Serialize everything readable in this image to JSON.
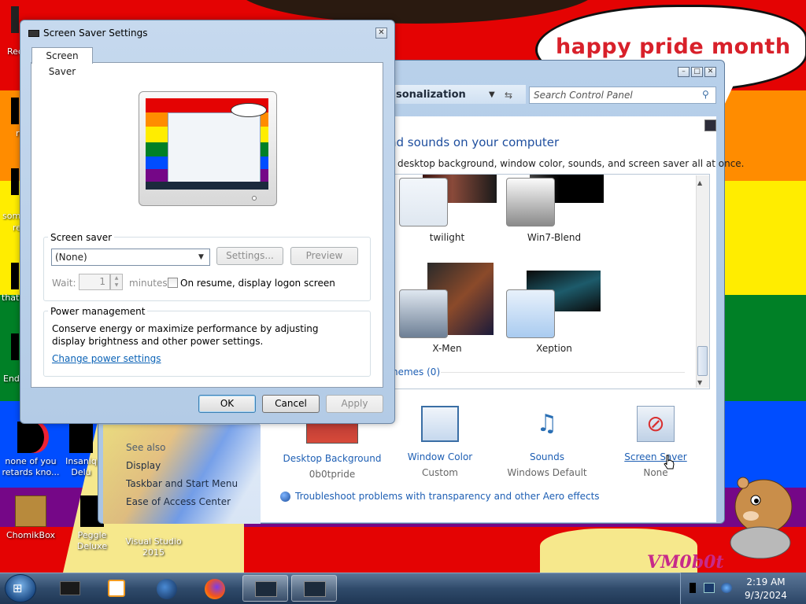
{
  "wallpaper": {
    "speech_text": "happy pride month",
    "watermark": "VM0b0t",
    "stripe_colors": [
      "#e40303",
      "#ff8c00",
      "#ffed00",
      "#008026",
      "#004dff",
      "#750787"
    ]
  },
  "desktop_icons": [
    {
      "label": "none of you retards kno...",
      "icon": "red-circle-icon"
    },
    {
      "label": "Insaniq Delu",
      "icon": "red-circle-icon"
    },
    {
      "label": "ChomikBox",
      "icon": "chomikbox-icon"
    },
    {
      "label": "Peggle Deluxe",
      "icon": "peggle-icon"
    },
    {
      "label": "Visual Studio 2015",
      "icon": "visual-studio-icon"
    }
  ],
  "desktop_edge_labels": [
    "Rec",
    "r",
    "som",
    "re",
    "that",
    "End"
  ],
  "personalization": {
    "breadcrumb": "sonalization",
    "search_placeholder": "Search Control Panel",
    "heading": "nd sounds on your computer",
    "subheading": "desktop background, window color, sounds, and screen saver all at once.",
    "themes": [
      {
        "name": "twilight"
      },
      {
        "name": "Win7-Blend"
      },
      {
        "name": "X-Men"
      },
      {
        "name": "Xeption"
      }
    ],
    "themes_link": "hemes (0)",
    "items": [
      {
        "label": "Desktop Background",
        "value": "0b0tpride",
        "icon": "desktop-background-icon"
      },
      {
        "label": "Window Color",
        "value": "Custom",
        "icon": "window-color-icon"
      },
      {
        "label": "Sounds",
        "value": "Windows Default",
        "icon": "sounds-icon"
      },
      {
        "label": "Screen Saver",
        "value": "None",
        "icon": "screen-saver-icon"
      }
    ],
    "troubleshoot_link": "Troubleshoot problems with transparency and other Aero effects",
    "see_also": {
      "heading": "See also",
      "links": [
        "Display",
        "Taskbar and Start Menu",
        "Ease of Access Center"
      ]
    }
  },
  "screen_saver_dialog": {
    "title": "Screen Saver Settings",
    "tab": "Screen Saver",
    "screen_saver_group": "Screen saver",
    "selected_saver": "(None)",
    "settings_button": "Settings...",
    "preview_button": "Preview",
    "wait_label": "Wait:",
    "wait_value": "1",
    "minutes_label": "minutes",
    "resume_checkbox_label": "On resume, display logon screen",
    "resume_checked": false,
    "power_group": "Power management",
    "power_description": "Conserve energy or maximize performance by adjusting display brightness and other power settings.",
    "power_link": "Change power settings",
    "ok_button": "OK",
    "cancel_button": "Cancel",
    "apply_button": "Apply"
  },
  "taskbar": {
    "start_icon": "windows-orb-icon",
    "pinned": [
      "terminal-icon",
      "media-player-icon",
      "globe-icon",
      "firefox-icon",
      "personalization-window-icon",
      "screen-saver-window-icon"
    ],
    "clock_time": "2:19 AM",
    "clock_date": "9/3/2024"
  }
}
